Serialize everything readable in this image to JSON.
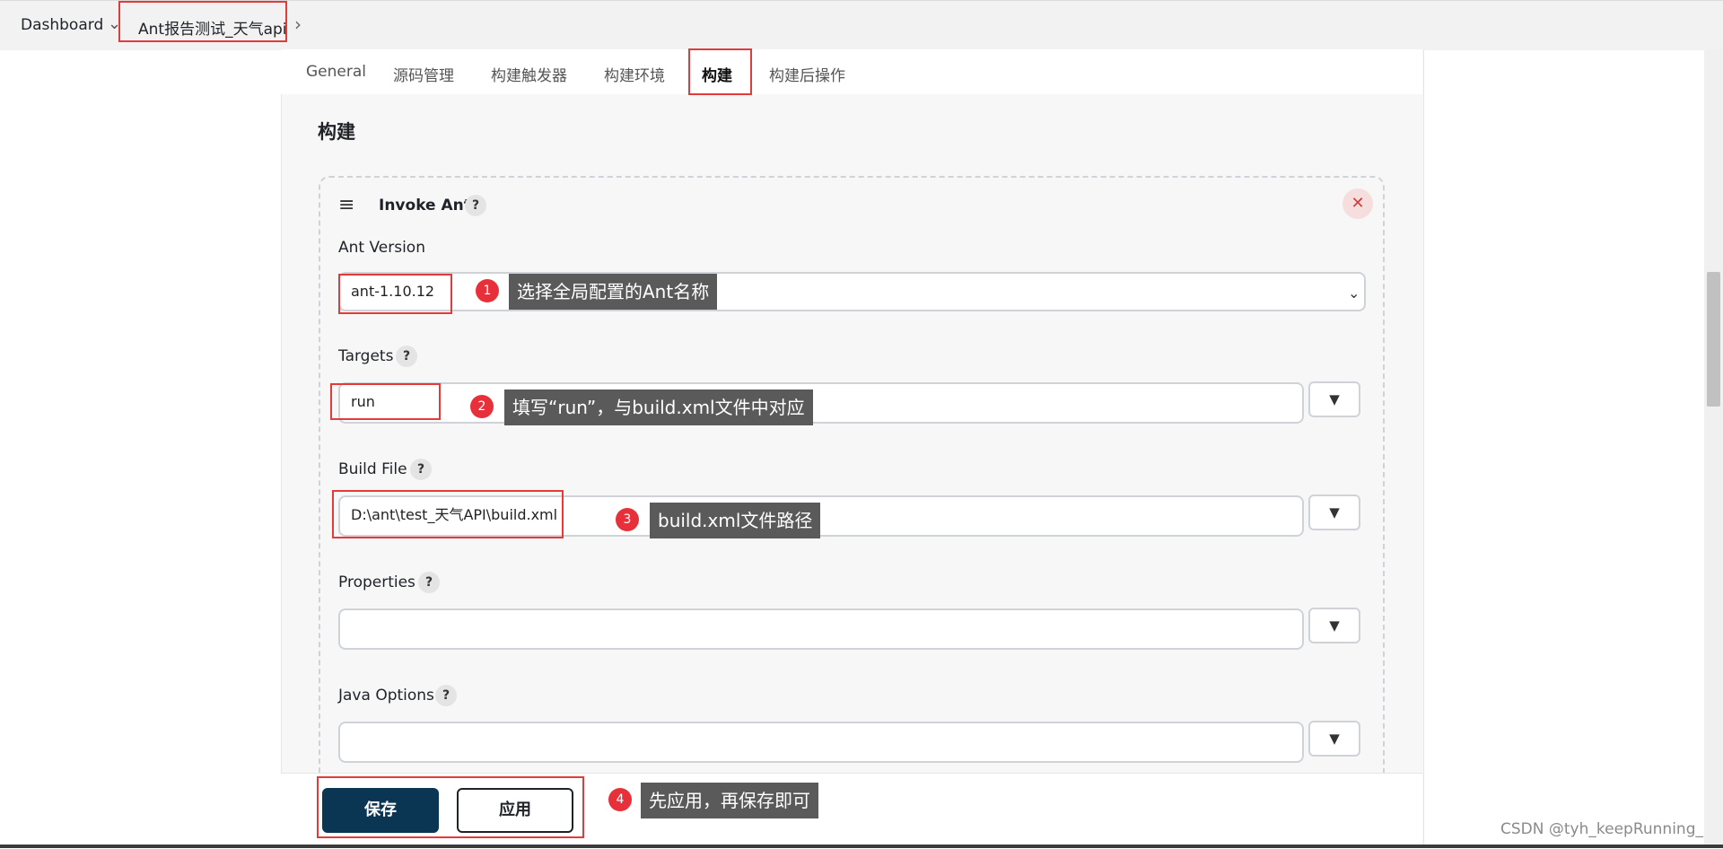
{
  "breadcrumb": {
    "dashboard": "Dashboard",
    "job": "Ant报告测试_天气api"
  },
  "tabs": [
    "General",
    "源码管理",
    "构建触发器",
    "构建环境",
    "构建",
    "构建后操作"
  ],
  "section": {
    "title": "构建"
  },
  "card": {
    "title": "Invoke Ant",
    "help": "?",
    "close": "✕"
  },
  "fields": {
    "ant_version": {
      "label": "Ant Version",
      "value": "ant-1.10.12"
    },
    "targets": {
      "label": "Targets",
      "value": "run"
    },
    "build_file": {
      "label": "Build File",
      "value": "D:\\ant\\test_天气API\\build.xml"
    },
    "properties": {
      "label": "Properties",
      "value": ""
    },
    "java_options": {
      "label": "Java Options",
      "value": ""
    }
  },
  "annotations": [
    {
      "num": "1",
      "text": "选择全局配置的Ant名称"
    },
    {
      "num": "2",
      "text": "填写“run”，与build.xml文件中对应"
    },
    {
      "num": "3",
      "text": "build.xml文件路径"
    },
    {
      "num": "4",
      "text": "先应用，再保存即可"
    }
  ],
  "buttons": {
    "save": "保存",
    "apply": "应用"
  },
  "watermark": "CSDN @tyh_keepRunning_",
  "colors": {
    "accent": "#e33a3a",
    "primary": "#0a3553",
    "tip_bg": "#5a5a5a"
  },
  "icons": {
    "drag": "drag-handle-icon",
    "chevron": "chevron-down-icon",
    "dropdown": "triangle-down-icon"
  }
}
